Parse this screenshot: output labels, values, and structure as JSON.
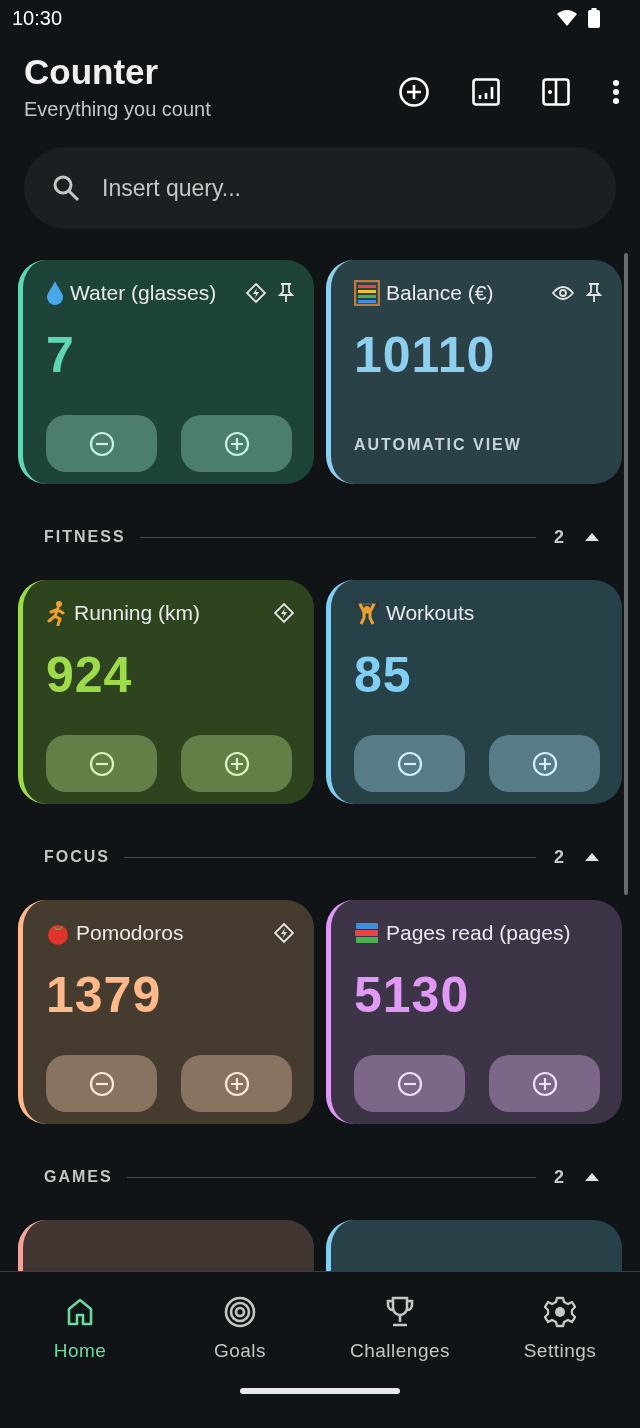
{
  "status_bar": {
    "time": "10:30"
  },
  "header": {
    "title": "Counter",
    "subtitle": "Everything you count"
  },
  "search": {
    "placeholder": "Insert query..."
  },
  "pinned": [
    {
      "kind": "counter",
      "title": "Water (glasses)",
      "value": "7",
      "color": "#5fd6b4",
      "automated": true,
      "pinned": true,
      "watched": false
    },
    {
      "kind": "automatic",
      "title": "Balance (€)",
      "value": "10110",
      "color": "#8ccfef",
      "automated": false,
      "pinned": true,
      "watched": true,
      "footer": "AUTOMATIC VIEW"
    }
  ],
  "sections": [
    {
      "name": "FITNESS",
      "count": "2",
      "expanded": true,
      "counters": [
        {
          "kind": "counter",
          "title": "Running (km)",
          "value": "924",
          "color": "#9ddb4a",
          "automated": true,
          "pinned": false,
          "watched": false
        },
        {
          "kind": "counter",
          "title": "Workouts",
          "value": "85",
          "color": "#82cff6",
          "automated": false,
          "pinned": false,
          "watched": false
        }
      ]
    },
    {
      "name": "FOCUS",
      "count": "2",
      "expanded": true,
      "counters": [
        {
          "kind": "counter",
          "title": "Pomodoros",
          "value": "1379",
          "color": "#ffb98a",
          "automated": true,
          "pinned": false,
          "watched": false
        },
        {
          "kind": "counter",
          "title": "Pages read (pages)",
          "value": "5130",
          "color": "#e09af5",
          "automated": false,
          "pinned": false,
          "watched": false
        }
      ]
    },
    {
      "name": "GAMES",
      "count": "2",
      "expanded": true,
      "counters": [
        {
          "kind": "partial",
          "color": "#f2a39c"
        },
        {
          "kind": "partial",
          "color": "#86cdf2"
        }
      ]
    }
  ],
  "nav": [
    {
      "label": "Home",
      "selected": true
    },
    {
      "label": "Goals",
      "selected": false
    },
    {
      "label": "Challenges",
      "selected": false
    },
    {
      "label": "Settings",
      "selected": false
    }
  ]
}
